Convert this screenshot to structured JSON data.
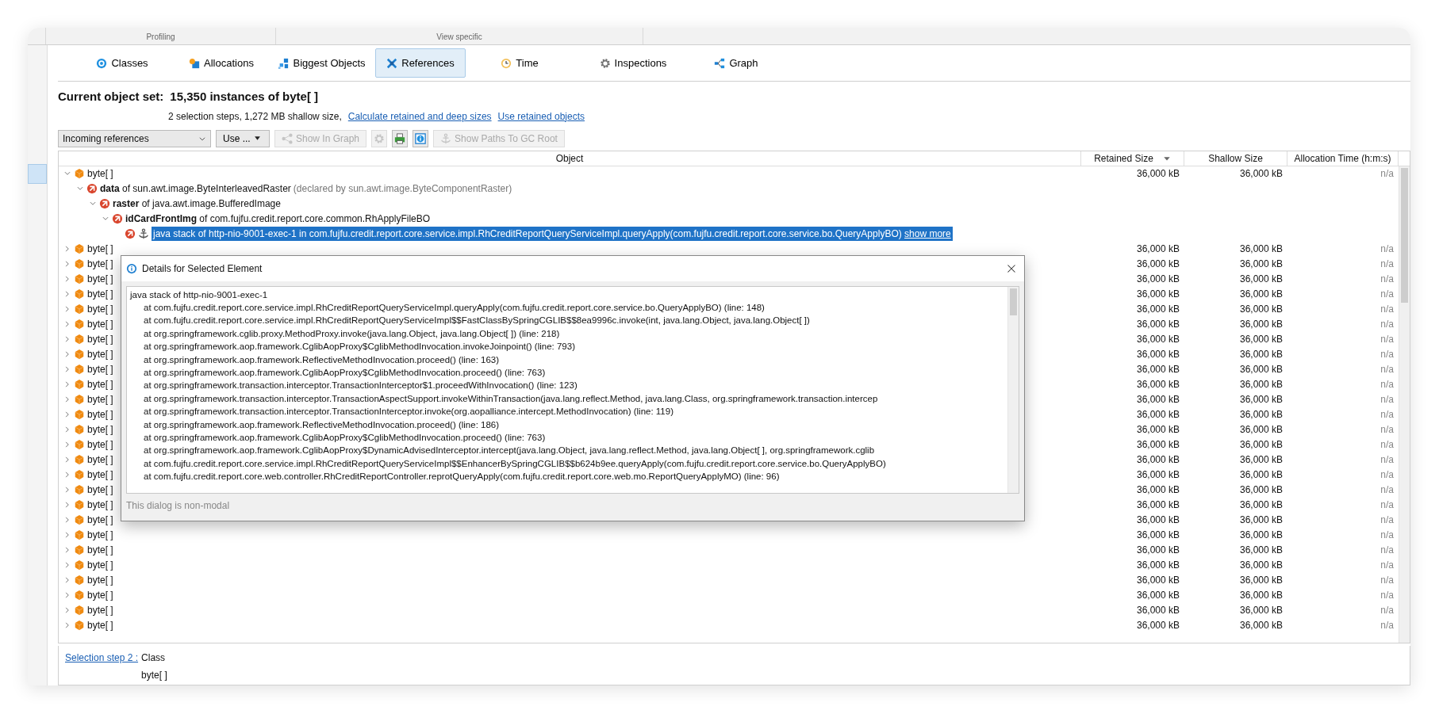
{
  "ribbon": {
    "groups": [
      "Profiling",
      "View specific"
    ]
  },
  "sidebar": {
    "items": [
      {
        "selected": true
      }
    ]
  },
  "tabs": [
    {
      "label": "Classes",
      "selected": false
    },
    {
      "label": "Allocations",
      "selected": false
    },
    {
      "label": "Biggest Objects",
      "selected": false
    },
    {
      "label": "References",
      "selected": true
    },
    {
      "label": "Time",
      "selected": false
    },
    {
      "label": "Inspections",
      "selected": false
    },
    {
      "label": "Graph",
      "selected": false
    }
  ],
  "current_object_set": {
    "label": "Current object set:",
    "value": "15,350 instances of byte[ ]",
    "details": "2 selection steps, 1,272 MB shallow size,",
    "links": [
      "Calculate retained and deep sizes",
      "Use retained objects"
    ]
  },
  "toolbar": {
    "view_select": {
      "value": "Incoming references"
    },
    "buttons": [
      {
        "kind": "menu",
        "label": "Use ...",
        "disabled": false
      },
      {
        "kind": "text",
        "label": "Show In Graph",
        "disabled": true
      },
      {
        "kind": "icon",
        "disabled": true
      },
      {
        "kind": "icon",
        "disabled": false
      },
      {
        "kind": "icon",
        "disabled": false
      },
      {
        "kind": "text",
        "label": "Show Paths To GC Root",
        "disabled": true
      }
    ]
  },
  "table": {
    "columns": [
      {
        "label": "Object",
        "sorted": false
      },
      {
        "label": "Retained Size",
        "sorted": true
      },
      {
        "label": "Shallow Size",
        "sorted": false
      },
      {
        "label": "Allocation Time (h:m:s)",
        "sorted": false
      }
    ],
    "rows": [
      {
        "kind": "class",
        "label": "byte[ ]",
        "expanded": true,
        "selected": false,
        "retained_size": "36,000 kB",
        "shallow_size": "36,000 kB",
        "allocation_time": "n/a",
        "children": [
          {
            "kind": "field",
            "label": "**data** of sun.awt.image.ByteInterleavedRaster",
            "note": "(declared by sun.awt.image.ByteComponentRaster)",
            "expanded": true,
            "selected": false,
            "children": [
              {
                "kind": "field",
                "label": "**raster** of java.awt.image.BufferedImage",
                "expanded": true,
                "selected": false,
                "children": [
                  {
                    "kind": "field",
                    "label": "**idCardFrontImg** of com.fujfu.credit.report.core.common.RhApplyFileBO",
                    "expanded": true,
                    "selected": false,
                    "children": [
                      {
                        "kind": "stack",
                        "label": "java stack of http-nio-9001-exec-1 in com.fujfu.credit.report.core.service.impl.RhCreditReportQueryServiceImpl.queryApply(com.fujfu.credit.report.core.service.bo.QueryApplyBO)",
                        "link": "show more",
                        "selected": true
                      }
                    ]
                  }
                ]
              }
            ]
          }
        ]
      },
      {
        "kind": "class",
        "label": "byte[ ]",
        "expanded": false,
        "selected": false,
        "retained_size": "36,000 kB",
        "shallow_size": "36,000 kB",
        "allocation_time": "n/a"
      },
      {
        "kind": "class",
        "label": "byte[ ]",
        "expanded": false,
        "selected": false,
        "retained_size": "36,000 kB",
        "shallow_size": "36,000 kB",
        "allocation_time": "n/a"
      },
      {
        "kind": "class",
        "label": "byte[ ]",
        "expanded": false,
        "selected": false,
        "retained_size": "36,000 kB",
        "shallow_size": "36,000 kB",
        "allocation_time": "n/a"
      },
      {
        "kind": "class",
        "label": "byte[ ]",
        "expanded": false,
        "selected": false,
        "retained_size": "36,000 kB",
        "shallow_size": "36,000 kB",
        "allocation_time": "n/a"
      },
      {
        "kind": "class",
        "label": "byte[ ]",
        "expanded": false,
        "selected": false,
        "retained_size": "36,000 kB",
        "shallow_size": "36,000 kB",
        "allocation_time": "n/a"
      },
      {
        "kind": "class",
        "label": "byte[ ]",
        "expanded": false,
        "selected": false,
        "retained_size": "36,000 kB",
        "shallow_size": "36,000 kB",
        "allocation_time": "n/a"
      },
      {
        "kind": "class",
        "label": "byte[ ]",
        "expanded": false,
        "selected": false,
        "retained_size": "36,000 kB",
        "shallow_size": "36,000 kB",
        "allocation_time": "n/a"
      },
      {
        "kind": "class",
        "label": "byte[ ]",
        "expanded": false,
        "selected": false,
        "retained_size": "36,000 kB",
        "shallow_size": "36,000 kB",
        "allocation_time": "n/a"
      },
      {
        "kind": "class",
        "label": "byte[ ]",
        "expanded": false,
        "selected": false,
        "retained_size": "36,000 kB",
        "shallow_size": "36,000 kB",
        "allocation_time": "n/a"
      },
      {
        "kind": "class",
        "label": "byte[ ]",
        "expanded": false,
        "selected": false,
        "retained_size": "36,000 kB",
        "shallow_size": "36,000 kB",
        "allocation_time": "n/a"
      },
      {
        "kind": "class",
        "label": "byte[ ]",
        "expanded": false,
        "selected": false,
        "retained_size": "36,000 kB",
        "shallow_size": "36,000 kB",
        "allocation_time": "n/a"
      },
      {
        "kind": "class",
        "label": "byte[ ]",
        "expanded": false,
        "selected": false,
        "retained_size": "36,000 kB",
        "shallow_size": "36,000 kB",
        "allocation_time": "n/a"
      },
      {
        "kind": "class",
        "label": "byte[ ]",
        "expanded": false,
        "selected": false,
        "retained_size": "36,000 kB",
        "shallow_size": "36,000 kB",
        "allocation_time": "n/a"
      },
      {
        "kind": "class",
        "label": "byte[ ]",
        "expanded": false,
        "selected": false,
        "retained_size": "36,000 kB",
        "shallow_size": "36,000 kB",
        "allocation_time": "n/a"
      },
      {
        "kind": "class",
        "label": "byte[ ]",
        "expanded": false,
        "selected": false,
        "retained_size": "36,000 kB",
        "shallow_size": "36,000 kB",
        "allocation_time": "n/a"
      },
      {
        "kind": "class",
        "label": "byte[ ]",
        "expanded": false,
        "selected": false,
        "retained_size": "36,000 kB",
        "shallow_size": "36,000 kB",
        "allocation_time": "n/a"
      },
      {
        "kind": "class",
        "label": "byte[ ]",
        "expanded": false,
        "selected": false,
        "retained_size": "36,000 kB",
        "shallow_size": "36,000 kB",
        "allocation_time": "n/a"
      },
      {
        "kind": "class",
        "label": "byte[ ]",
        "expanded": false,
        "selected": false,
        "retained_size": "36,000 kB",
        "shallow_size": "36,000 kB",
        "allocation_time": "n/a"
      },
      {
        "kind": "class",
        "label": "byte[ ]",
        "expanded": false,
        "selected": false,
        "retained_size": "36,000 kB",
        "shallow_size": "36,000 kB",
        "allocation_time": "n/a"
      },
      {
        "kind": "class",
        "label": "byte[ ]",
        "expanded": false,
        "selected": false,
        "retained_size": "36,000 kB",
        "shallow_size": "36,000 kB",
        "allocation_time": "n/a"
      },
      {
        "kind": "class",
        "label": "byte[ ]",
        "expanded": false,
        "selected": false,
        "retained_size": "36,000 kB",
        "shallow_size": "36,000 kB",
        "allocation_time": "n/a"
      },
      {
        "kind": "class",
        "label": "byte[ ]",
        "expanded": false,
        "selected": false,
        "retained_size": "36,000 kB",
        "shallow_size": "36,000 kB",
        "allocation_time": "n/a"
      },
      {
        "kind": "class",
        "label": "byte[ ]",
        "expanded": false,
        "selected": false,
        "retained_size": "36,000 kB",
        "shallow_size": "36,000 kB",
        "allocation_time": "n/a"
      },
      {
        "kind": "class",
        "label": "byte[ ]",
        "expanded": false,
        "selected": false,
        "retained_size": "36,000 kB",
        "shallow_size": "36,000 kB",
        "allocation_time": "n/a"
      },
      {
        "kind": "class",
        "label": "byte[ ]",
        "expanded": false,
        "selected": false,
        "retained_size": "36,000 kB",
        "shallow_size": "36,000 kB",
        "allocation_time": "n/a"
      },
      {
        "kind": "class",
        "label": "byte[ ]",
        "expanded": false,
        "selected": false,
        "retained_size": "36,000 kB",
        "shallow_size": "36,000 kB",
        "allocation_time": "n/a"
      }
    ]
  },
  "details_dialog": {
    "title": "Details for Selected Element",
    "heading": "java stack of http-nio-9001-exec-1",
    "frames": [
      "at com.fujfu.credit.report.core.service.impl.RhCreditReportQueryServiceImpl.queryApply(com.fujfu.credit.report.core.service.bo.QueryApplyBO) (line: 148)",
      "at com.fujfu.credit.report.core.service.impl.RhCreditReportQueryServiceImpl$$FastClassBySpringCGLIB$$8ea9996c.invoke(int, java.lang.Object, java.lang.Object[ ])",
      "at org.springframework.cglib.proxy.MethodProxy.invoke(java.lang.Object, java.lang.Object[ ]) (line: 218)",
      "at org.springframework.aop.framework.CglibAopProxy$CglibMethodInvocation.invokeJoinpoint() (line: 793)",
      "at org.springframework.aop.framework.ReflectiveMethodInvocation.proceed() (line: 163)",
      "at org.springframework.aop.framework.CglibAopProxy$CglibMethodInvocation.proceed() (line: 763)",
      "at org.springframework.transaction.interceptor.TransactionInterceptor$1.proceedWithInvocation() (line: 123)",
      "at org.springframework.transaction.interceptor.TransactionAspectSupport.invokeWithinTransaction(java.lang.reflect.Method, java.lang.Class, org.springframework.transaction.intercep",
      "at org.springframework.transaction.interceptor.TransactionInterceptor.invoke(org.aopalliance.intercept.MethodInvocation) (line: 119)",
      "at org.springframework.aop.framework.ReflectiveMethodInvocation.proceed() (line: 186)",
      "at org.springframework.aop.framework.CglibAopProxy$CglibMethodInvocation.proceed() (line: 763)",
      "at org.springframework.aop.framework.CglibAopProxy$DynamicAdvisedInterceptor.intercept(java.lang.Object, java.lang.reflect.Method, java.lang.Object[ ], org.springframework.cglib",
      "at com.fujfu.credit.report.core.service.impl.RhCreditReportQueryServiceImpl$$EnhancerBySpringCGLIB$$b624b9ee.queryApply(com.fujfu.credit.report.core.service.bo.QueryApplyBO)",
      "at com.fujfu.credit.report.core.web.controller.RhCreditReportController.reprotQueryApply(com.fujfu.credit.report.core.web.mo.ReportQueryApplyMO) (line: 96)"
    ],
    "footer": "This dialog is non-modal"
  },
  "selection_panel": {
    "link": "Selection step 2 :",
    "label": "Class",
    "value": "byte[ ]"
  }
}
